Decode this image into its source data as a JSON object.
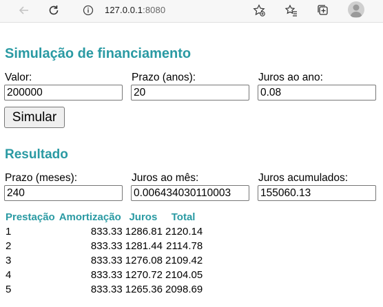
{
  "browser": {
    "url_host": "127.0.0.1",
    "url_port": ":8080"
  },
  "simulation": {
    "title": "Simulação de financiamento",
    "valor_label": "Valor:",
    "valor_value": "200000",
    "prazo_label": "Prazo (anos):",
    "prazo_value": "20",
    "juros_label": "Juros ao ano:",
    "juros_value": "0.08",
    "submit_label": "Simular"
  },
  "result": {
    "title": "Resultado",
    "prazo_meses_label": "Prazo (meses):",
    "prazo_meses_value": "240",
    "juros_mes_label": "Juros ao mês:",
    "juros_mes_value": "0.006434030110003",
    "juros_acum_label": "Juros acumulados:",
    "juros_acum_value": "155060.13"
  },
  "table": {
    "headers": [
      "Prestação",
      "Amortização",
      "Juros",
      "Total"
    ],
    "rows": [
      [
        "1",
        "833.33",
        "1286.81",
        "2120.14"
      ],
      [
        "2",
        "833.33",
        "1281.44",
        "2114.78"
      ],
      [
        "3",
        "833.33",
        "1276.08",
        "2109.42"
      ],
      [
        "4",
        "833.33",
        "1270.72",
        "2104.05"
      ],
      [
        "5",
        "833.33",
        "1265.36",
        "2098.69"
      ]
    ]
  },
  "colors": {
    "accent": "#2a9aa3"
  }
}
